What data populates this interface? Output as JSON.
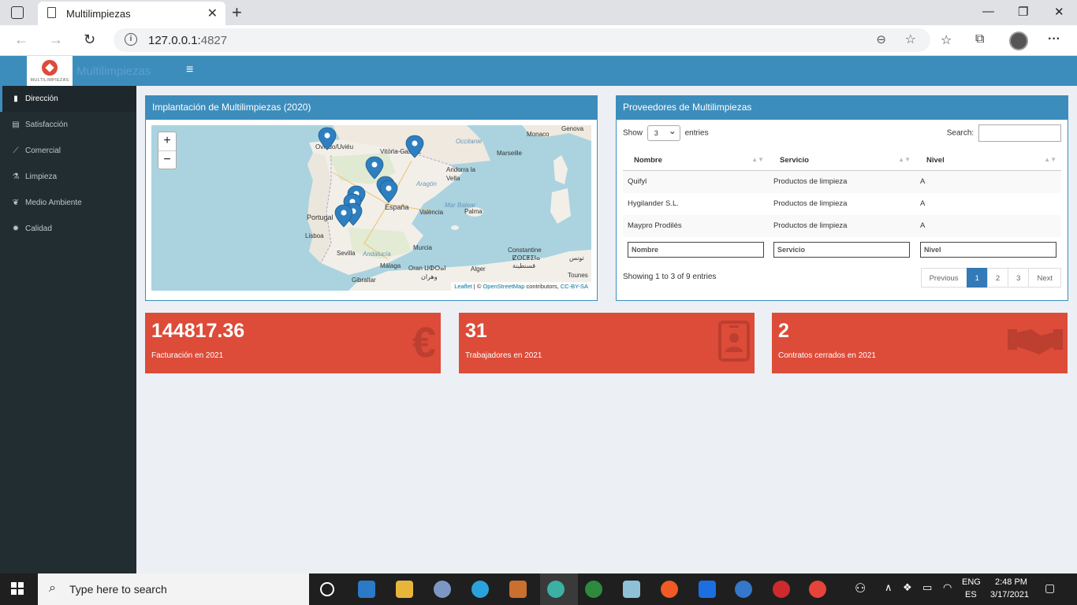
{
  "browser": {
    "tab_title": "Multilimpiezas",
    "url_host": "127.0.0.1:",
    "url_port": "4827"
  },
  "header": {
    "logo_text": "MULTILIMPIEZAS",
    "brand": "Multilimpiezas",
    "menu_icon": "hamburger-icon"
  },
  "sidebar": {
    "items": [
      {
        "label": "Dirección",
        "icon": "dashboard-icon"
      },
      {
        "label": "Satisfacción",
        "icon": "clipboard-icon"
      },
      {
        "label": "Comercial",
        "icon": "line-chart-icon"
      },
      {
        "label": "Limpieza",
        "icon": "cleaning-icon"
      },
      {
        "label": "Medio Ambiente",
        "icon": "leaf-icon"
      },
      {
        "label": "Calidad",
        "icon": "gear-icon"
      }
    ]
  },
  "map_box": {
    "title": "Implantación de Multilimpiezas (2020)",
    "zoom_in": "+",
    "zoom_out": "−",
    "attribution_leaflet": "Leaflet",
    "attribution_sep": " | © ",
    "attribution_osm": "OpenStreetMap",
    "attribution_contrib": " contributors, ",
    "attribution_license": "CC-BY-SA",
    "labels": {
      "oviedo": "Oviedo/Uviéu",
      "vitoria": "Vitoria-Gasteiz",
      "monaco": "Monaco",
      "genova": "Genova",
      "occitanie": "Occitanie",
      "marseille": "Marseille",
      "andorra": "Andorra la Vella",
      "aragon": "Aragón",
      "espana": "España",
      "valencia": "València",
      "mar_balear": "Mar Balear",
      "palma": "Palma",
      "portugal": "Portugal",
      "lisboa": "Lisboa",
      "sevilla": "Sevilla",
      "andalucia": "Andalucía",
      "murcia": "Murcia",
      "malaga": "Málaga",
      "gibraltar": "Gibraltar",
      "oran": "Oran ⵡⵀⵔⴰⵏ",
      "oran_ar": "وهران",
      "alger": "Alger",
      "constantine": "Constantine",
      "constantine_tfn": "ⵇⵙⵎⵟⵉⵏⴰ",
      "constantine_ar": "قسنطينة",
      "tunis": "تونس",
      "tounes": "Tounes"
    }
  },
  "suppliers": {
    "title": "Proveedores de Multilimpiezas",
    "show_label": "Show",
    "entries_value": "3",
    "entries_label": "entries",
    "search_label": "Search:",
    "columns": [
      "Nombre",
      "Servicio",
      "Nivel"
    ],
    "rows": [
      [
        "Quifyl",
        "Productos de limpieza",
        "A"
      ],
      [
        "Hygilander S.L.",
        "Productos de limpieza",
        "A"
      ],
      [
        "Maypro Prodilés",
        "Productos de limpieza",
        "A"
      ]
    ],
    "filters": [
      "Nombre",
      "Servicio",
      "Nivel"
    ],
    "info": "Showing 1 to 3 of 9 entries",
    "pager": [
      "Previous",
      "1",
      "2",
      "3",
      "Next"
    ]
  },
  "kpis": [
    {
      "value": "144817.36",
      "label": "Facturación en 2021",
      "icon": "euro-icon"
    },
    {
      "value": "31",
      "label": "Trabajadores en 2021",
      "icon": "id-badge-icon"
    },
    {
      "value": "2",
      "label": "Contratos cerrados en 2021",
      "icon": "handshake-icon"
    }
  ],
  "taskbar": {
    "search_placeholder": "Type here to search",
    "lang_top": "ENG",
    "lang_bottom": "ES",
    "time": "2:48 PM",
    "date": "3/17/2021"
  },
  "colors": {
    "primary": "#3c8dbc",
    "sidebar": "#222d32",
    "kpi": "#dd4b39",
    "page_bg": "#ecf0f5"
  }
}
